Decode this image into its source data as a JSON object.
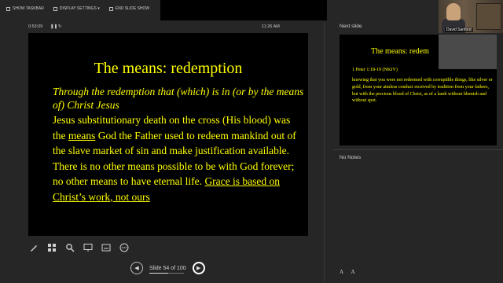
{
  "toolbar": {
    "show_taskbar": "SHOW TASKBAR",
    "display_settings": "DISPLAY SETTINGS ▾",
    "end_slide_show": "END SLIDE SHOW"
  },
  "video": {
    "participant_name": "David Sanford"
  },
  "presenter": {
    "timer": "0:53:09",
    "clock": "11:26 AM"
  },
  "slide": {
    "title": "The means: redemption",
    "subtitle": "Through the redemption that (which) is in (or by the means of) Christ Jesus",
    "body_1": "Jesus substitutionary death on the cross (His blood) was the ",
    "body_means": "means",
    "body_2": " God the Father used to redeem mankind out of the slave market of sin and make justification available. There is no other means possible to be with God forever; no other means to have eternal life. ",
    "body_grace": "Grace is based on Christ’s work, not ours"
  },
  "navigation": {
    "counter": "Slide 54 of 100",
    "current": 54,
    "total": 100
  },
  "next_slide": {
    "label": "Next slide",
    "title": "The means: redem",
    "verse": "1 Peter 1:18-19 (NKJV)",
    "text": "knowing that you were not redeemed with corruptible things, like silver or gold, from your aimless conduct received by tradition from your fathers, but with the precious blood of Christ, as of a lamb without blemish and without spot."
  },
  "notes": {
    "label": "No Notes"
  },
  "font_controls": {
    "increase": "A",
    "decrease": "A"
  },
  "icons": [
    "pen-icon",
    "all-slides-icon",
    "zoom-icon",
    "pointer-icon",
    "subtitles-icon",
    "more-options-icon",
    "prev-icon",
    "next-icon"
  ],
  "colors": {
    "slide_text": "#ffff00",
    "slide_bg": "#000000",
    "app_bg": "#262626"
  }
}
